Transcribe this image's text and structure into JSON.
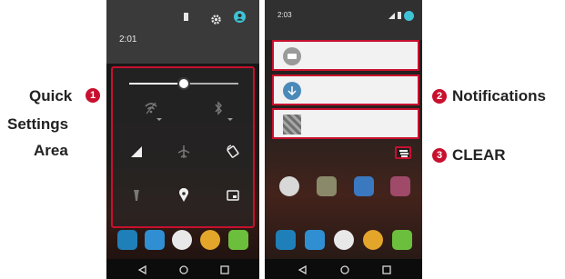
{
  "labels": {
    "quick_line1": "Quick",
    "quick_line2": "Settings",
    "quick_line3": "Area",
    "notifications": "Notifications",
    "clear": "CLEAR"
  },
  "badges": {
    "one": "1",
    "two": "2",
    "three": "3"
  },
  "phone1": {
    "time": "2:01",
    "brightness_level": 0.5
  },
  "phone2": {
    "time": "2:03"
  },
  "colors": {
    "accent": "#c8102e",
    "status_accent": "#3ec3d5"
  },
  "icons": {
    "quick_settings": [
      "wifi-icon",
      "bluetooth-icon",
      "signal-icon",
      "airplane-mode-icon",
      "rotate-icon",
      "flashlight-icon",
      "location-icon",
      "cast-icon"
    ],
    "notifications": [
      "message-icon",
      "download-icon",
      "app-thumbnail-icon"
    ],
    "nav": [
      "back-icon",
      "home-icon",
      "recents-icon"
    ]
  }
}
